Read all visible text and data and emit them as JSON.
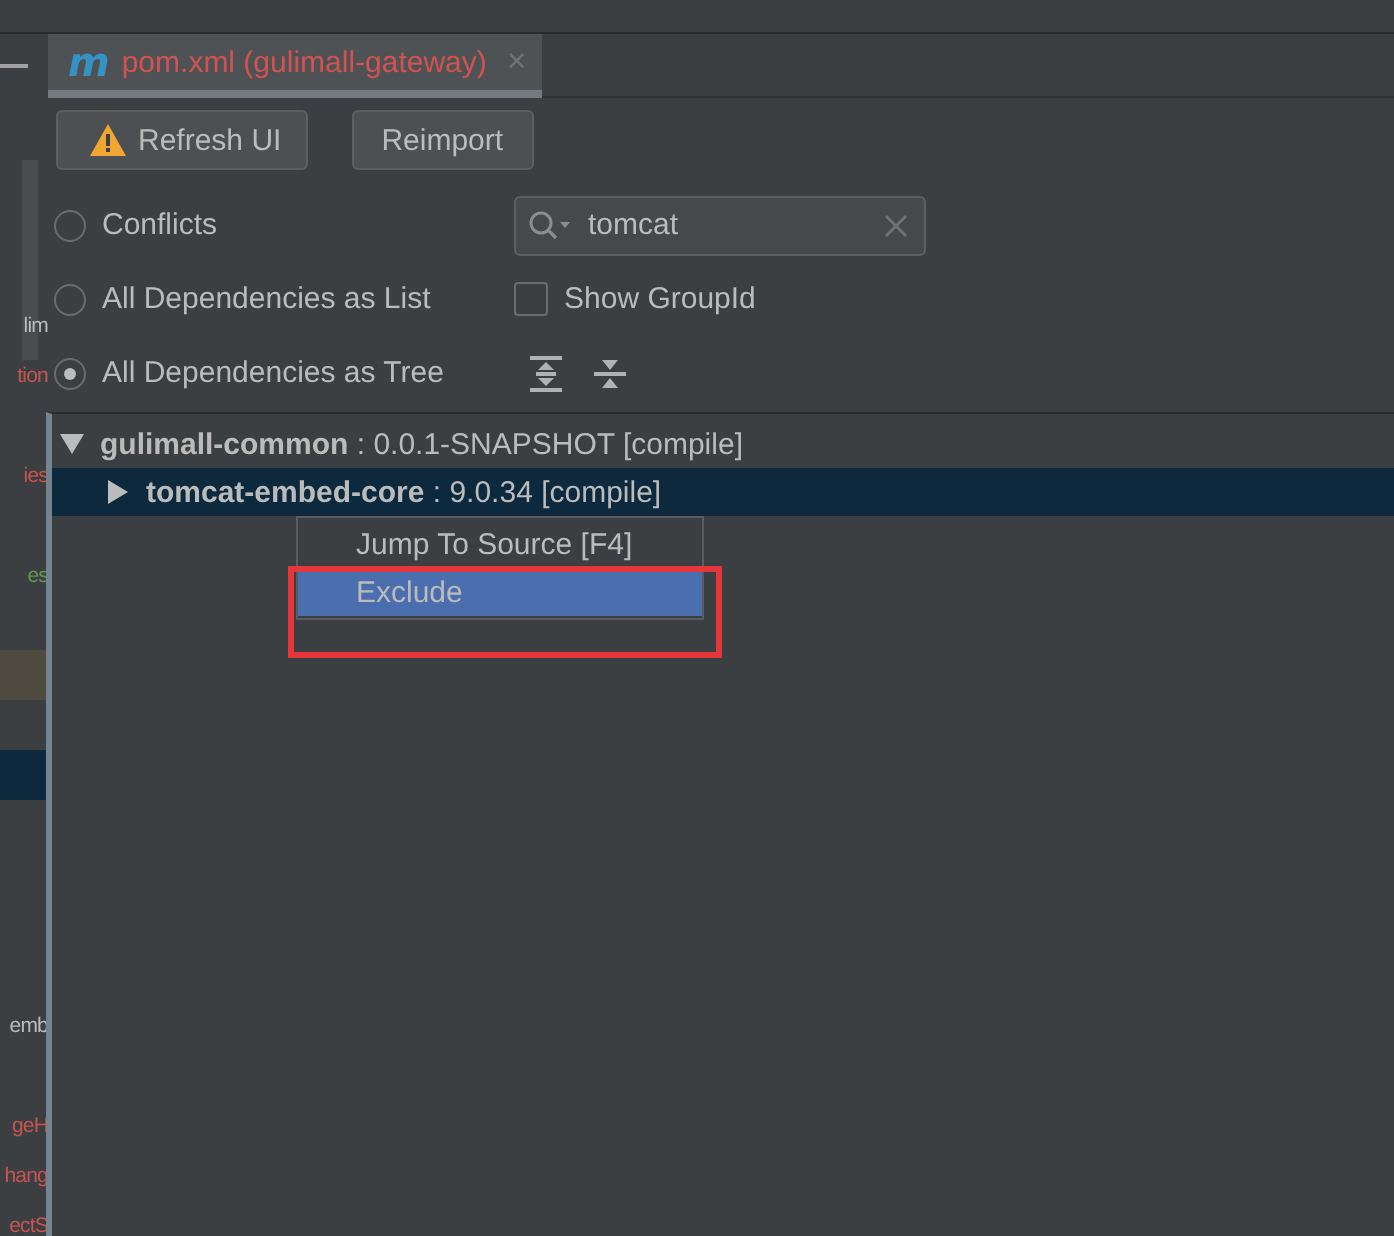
{
  "left_panel": {
    "items": [
      {
        "kind": "text",
        "text": "lim",
        "color": "#bbbbbb"
      },
      {
        "kind": "text",
        "text": "tion",
        "color": "#c75450"
      },
      {
        "kind": "blank"
      },
      {
        "kind": "text",
        "text": "ies",
        "color": "#c75450"
      },
      {
        "kind": "blank"
      },
      {
        "kind": "text",
        "text": "es",
        "color": "#629755"
      },
      {
        "kind": "blank"
      },
      {
        "kind": "caret_row"
      },
      {
        "kind": "blank"
      },
      {
        "kind": "selected_row"
      },
      {
        "kind": "blank"
      },
      {
        "kind": "blank"
      },
      {
        "kind": "blank"
      },
      {
        "kind": "blank"
      },
      {
        "kind": "text",
        "text": "emb",
        "color": "#bbbbbb"
      },
      {
        "kind": "blank"
      },
      {
        "kind": "text",
        "text": "geH",
        "color": "#c75450"
      },
      {
        "kind": "text",
        "text": "hang",
        "color": "#c75450"
      },
      {
        "kind": "text",
        "text": "ectS",
        "color": "#c75450"
      }
    ]
  },
  "editor_tab": {
    "logo": "m",
    "title": "pom.xml (gulimall-gateway)",
    "close": "×"
  },
  "toolbar": {
    "buttons": [
      {
        "label": "Refresh UI",
        "kind": "warning"
      },
      {
        "label": "Reimport",
        "kind": "plain"
      }
    ]
  },
  "modes": [
    {
      "label": "Conflicts",
      "selected": false
    },
    {
      "label": "All Dependencies as List",
      "selected": false
    },
    {
      "label": "All Dependencies as Tree",
      "selected": true
    }
  ],
  "search": {
    "value": "tomcat"
  },
  "show_group_id": {
    "label": "Show GroupId",
    "checked": false
  },
  "tree": [
    {
      "name": "gulimall-common",
      "detail": ": 0.0.1-SNAPSHOT [compile]",
      "expanded": true,
      "selected": false,
      "children": [
        {
          "name": "tomcat-embed-core",
          "detail": ": 9.0.34 [compile]",
          "expanded": false,
          "selected": true
        }
      ]
    }
  ],
  "context_menu": {
    "items": [
      {
        "label": "Jump To Source [F4]",
        "selected": false
      },
      {
        "label": "Exclude",
        "selected": true
      }
    ]
  }
}
